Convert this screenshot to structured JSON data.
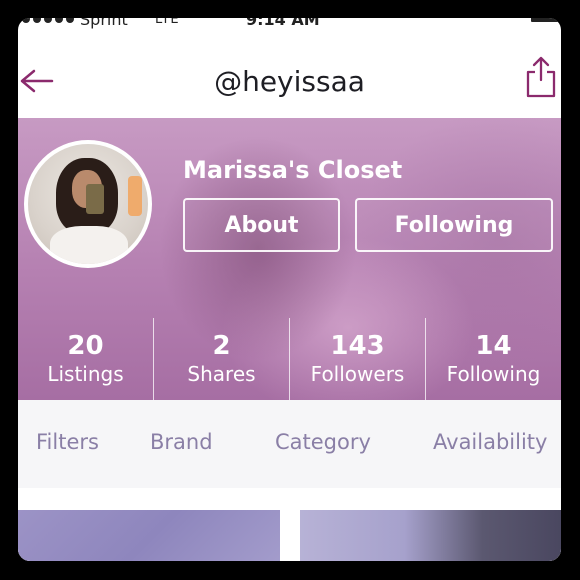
{
  "status_bar": {
    "carrier": "Sprint",
    "network": "LTE",
    "time": "9:14 AM"
  },
  "nav": {
    "username": "@heyissaa",
    "back_icon": "back-arrow-icon",
    "share_icon": "share-icon",
    "accent_color": "#8b2a6d"
  },
  "profile": {
    "closet_name": "Marissa's Closet",
    "about_label": "About",
    "following_button_label": "Following"
  },
  "stats": [
    {
      "value": "20",
      "label": "Listings"
    },
    {
      "value": "2",
      "label": "Shares"
    },
    {
      "value": "143",
      "label": "Followers"
    },
    {
      "value": "14",
      "label": "Following"
    }
  ],
  "filters": {
    "filters": "Filters",
    "brand": "Brand",
    "category": "Category",
    "availability": "Availability",
    "color": "#8a7fa6"
  }
}
